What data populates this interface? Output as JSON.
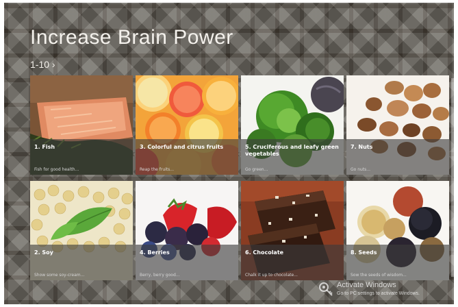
{
  "app": {
    "title": "Increase Brain Power",
    "count_label": "1-10 ›"
  },
  "tiles": [
    {
      "name": "1. Fish",
      "desc": "Fish for good health..."
    },
    {
      "name": "3. Colorful and citrus fruits",
      "desc": "Reap the fruits..."
    },
    {
      "name": "5. Cruciferous and leafy green vegetables",
      "desc": "Go green..."
    },
    {
      "name": "7. Nuts",
      "desc": "Go nuts..."
    },
    {
      "name": "2. Soy",
      "desc": "Show some soy-cream..."
    },
    {
      "name": "4. Berries",
      "desc": "Berry, berry good..."
    },
    {
      "name": "6. Chocolate",
      "desc": "Chalk it up to chocolate..."
    },
    {
      "name": "8. Seeds",
      "desc": "Sow the seeds of wisdom..."
    }
  ],
  "watermark": {
    "title": "Activate Windows",
    "subtitle": "Go to PC settings to activate Windows."
  },
  "icons": [
    "key-icon"
  ],
  "colors": {
    "tile_overlay": "#3c3c3c",
    "background": "#5e5a52"
  }
}
